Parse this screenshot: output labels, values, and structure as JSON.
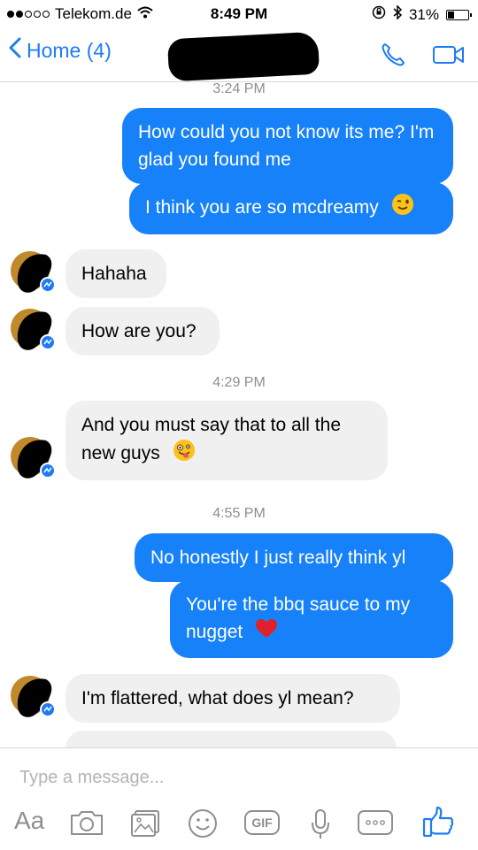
{
  "status_bar": {
    "carrier": "Telekom.de",
    "time": "8:49 PM",
    "battery": "31%",
    "battery_level": 0.31
  },
  "nav": {
    "back_label": "Home (4)"
  },
  "messages": [
    {
      "type": "timestamp",
      "text": "3:24 PM"
    },
    {
      "type": "outgoing",
      "text": "How could you not know its me? I'm glad you found me"
    },
    {
      "type": "outgoing",
      "text": "I think you are so mcdreamy",
      "emoji": "winking-face"
    },
    {
      "type": "incoming",
      "text": "Hahaha"
    },
    {
      "type": "incoming",
      "text": "How are you?"
    },
    {
      "type": "timestamp",
      "text": "4:29 PM"
    },
    {
      "type": "incoming",
      "text": "And you must say that to all the new guys",
      "emoji": "zany-face"
    },
    {
      "type": "timestamp",
      "text": "4:55 PM"
    },
    {
      "type": "outgoing",
      "text": "No honestly I just really think yl"
    },
    {
      "type": "outgoing",
      "text": "You're the bbq sauce to my nugget",
      "emoji": "red-heart"
    },
    {
      "type": "incoming",
      "text": "I'm flattered, what does yl mean?"
    }
  ],
  "composer": {
    "placeholder": "Type a message...",
    "aa_label": "Aa",
    "gif_label": "GIF"
  },
  "colors": {
    "accent": "#1f7bf4",
    "outgoing_bubble": "#1681f8",
    "incoming_bubble": "#f0f0f0"
  }
}
